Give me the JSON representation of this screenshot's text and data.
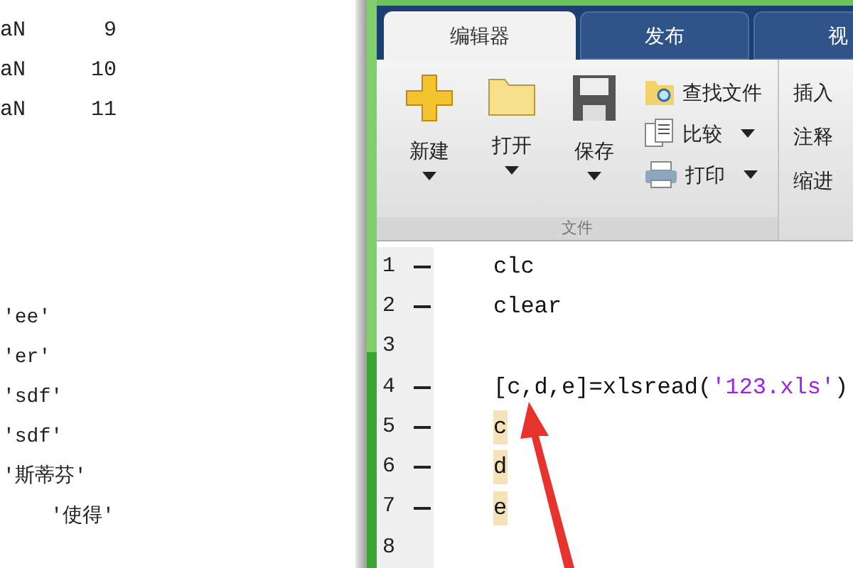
{
  "command_window": {
    "rows": [
      {
        "column_1": "aN",
        "column_2": "9"
      },
      {
        "column_1": "aN",
        "column_2": "10"
      },
      {
        "column_1": "aN",
        "column_2": "11"
      }
    ],
    "strings": [
      "'ee'",
      "'er'",
      "'sdf'",
      "'sdf'",
      "'斯蒂芬'",
      "    '使得'"
    ]
  },
  "tabs": [
    {
      "label": "编辑器",
      "selected": true
    },
    {
      "label": "发布",
      "selected": false
    },
    {
      "label": "视",
      "selected": false
    }
  ],
  "ribbon": {
    "large_buttons": [
      {
        "label": "新建",
        "kind": "new"
      },
      {
        "label": "打开",
        "kind": "open"
      },
      {
        "label": "保存",
        "kind": "save"
      }
    ],
    "small_buttons": [
      {
        "label": "查找文件",
        "kind": "find",
        "dropdown": false
      },
      {
        "label": "比较",
        "kind": "compare",
        "dropdown": true
      },
      {
        "label": "打印",
        "kind": "print",
        "dropdown": true
      }
    ],
    "section_label": "文件",
    "edit_buttons": [
      "插入",
      "注释",
      "缩进"
    ]
  },
  "editor": {
    "lines": [
      {
        "number": "1",
        "executable": true,
        "highlighted": false,
        "tokens": [
          {
            "text": "clc",
            "kind": "plain"
          }
        ]
      },
      {
        "number": "2",
        "executable": true,
        "highlighted": false,
        "tokens": [
          {
            "text": "clear",
            "kind": "plain"
          }
        ]
      },
      {
        "number": "3",
        "executable": false,
        "highlighted": false
      },
      {
        "number": "4",
        "executable": true,
        "highlighted": false,
        "tokens": [
          {
            "text": "[c,d,e]=xlsread(",
            "kind": "plain"
          },
          {
            "text": "'123.xls'",
            "kind": "string"
          },
          {
            "text": ")",
            "kind": "plain"
          }
        ]
      },
      {
        "number": "5",
        "executable": true,
        "highlighted": true,
        "tokens": [
          {
            "text": "c",
            "kind": "plain"
          }
        ]
      },
      {
        "number": "6",
        "executable": true,
        "highlighted": true,
        "tokens": [
          {
            "text": "d",
            "kind": "plain"
          }
        ]
      },
      {
        "number": "7",
        "executable": true,
        "highlighted": true,
        "tokens": [
          {
            "text": "e",
            "kind": "plain"
          }
        ]
      },
      {
        "number": "8",
        "executable": false,
        "highlighted": false
      }
    ]
  }
}
